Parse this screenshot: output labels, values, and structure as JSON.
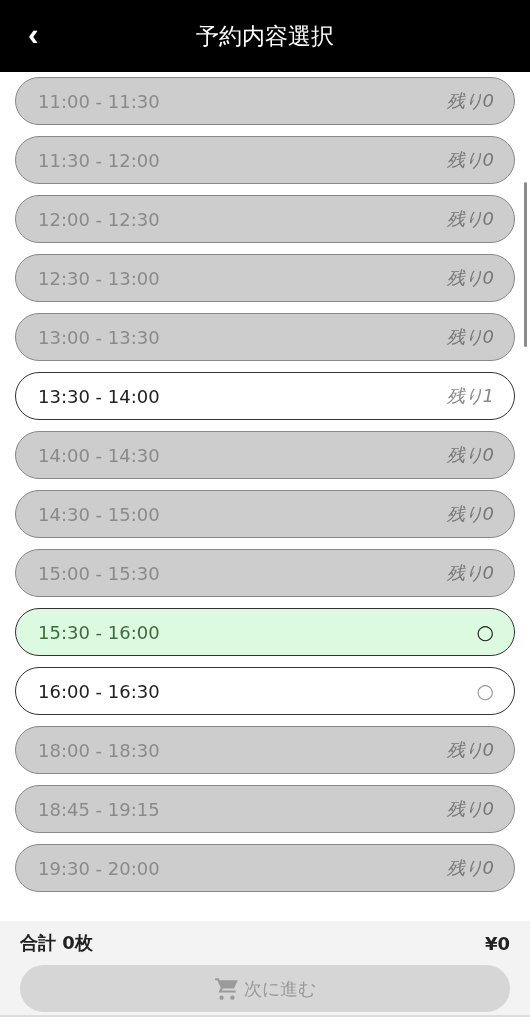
{
  "header": {
    "back": "‹",
    "title": "予約内容選択"
  },
  "slots": [
    {
      "time": "11:00 - 11:30",
      "kind": "count",
      "status": "残り0",
      "disabled": true,
      "selected": false
    },
    {
      "time": "11:30 - 12:00",
      "kind": "count",
      "status": "残り0",
      "disabled": true,
      "selected": false
    },
    {
      "time": "12:00 - 12:30",
      "kind": "count",
      "status": "残り0",
      "disabled": true,
      "selected": false
    },
    {
      "time": "12:30 - 13:00",
      "kind": "count",
      "status": "残り0",
      "disabled": true,
      "selected": false
    },
    {
      "time": "13:00 - 13:30",
      "kind": "count",
      "status": "残り0",
      "disabled": true,
      "selected": false
    },
    {
      "time": "13:30 - 14:00",
      "kind": "count",
      "status": "残り1",
      "disabled": false,
      "selected": false
    },
    {
      "time": "14:00 - 14:30",
      "kind": "count",
      "status": "残り0",
      "disabled": true,
      "selected": false
    },
    {
      "time": "14:30 - 15:00",
      "kind": "count",
      "status": "残り0",
      "disabled": true,
      "selected": false
    },
    {
      "time": "15:00 - 15:30",
      "kind": "count",
      "status": "残り0",
      "disabled": true,
      "selected": false
    },
    {
      "time": "15:30 - 16:00",
      "kind": "mark",
      "status": "○",
      "disabled": false,
      "selected": true
    },
    {
      "time": "16:00 - 16:30",
      "kind": "mark",
      "status": "○",
      "disabled": false,
      "selected": false
    },
    {
      "time": "18:00 - 18:30",
      "kind": "count",
      "status": "残り0",
      "disabled": true,
      "selected": false
    },
    {
      "time": "18:45 - 19:15",
      "kind": "count",
      "status": "残り0",
      "disabled": true,
      "selected": false
    },
    {
      "time": "19:30 - 20:00",
      "kind": "count",
      "status": "残り0",
      "disabled": true,
      "selected": false
    }
  ],
  "footer": {
    "total_label": "合計 0枚",
    "total_price": "¥0",
    "next_button": {
      "label": "次に進む",
      "disabled": true
    }
  }
}
